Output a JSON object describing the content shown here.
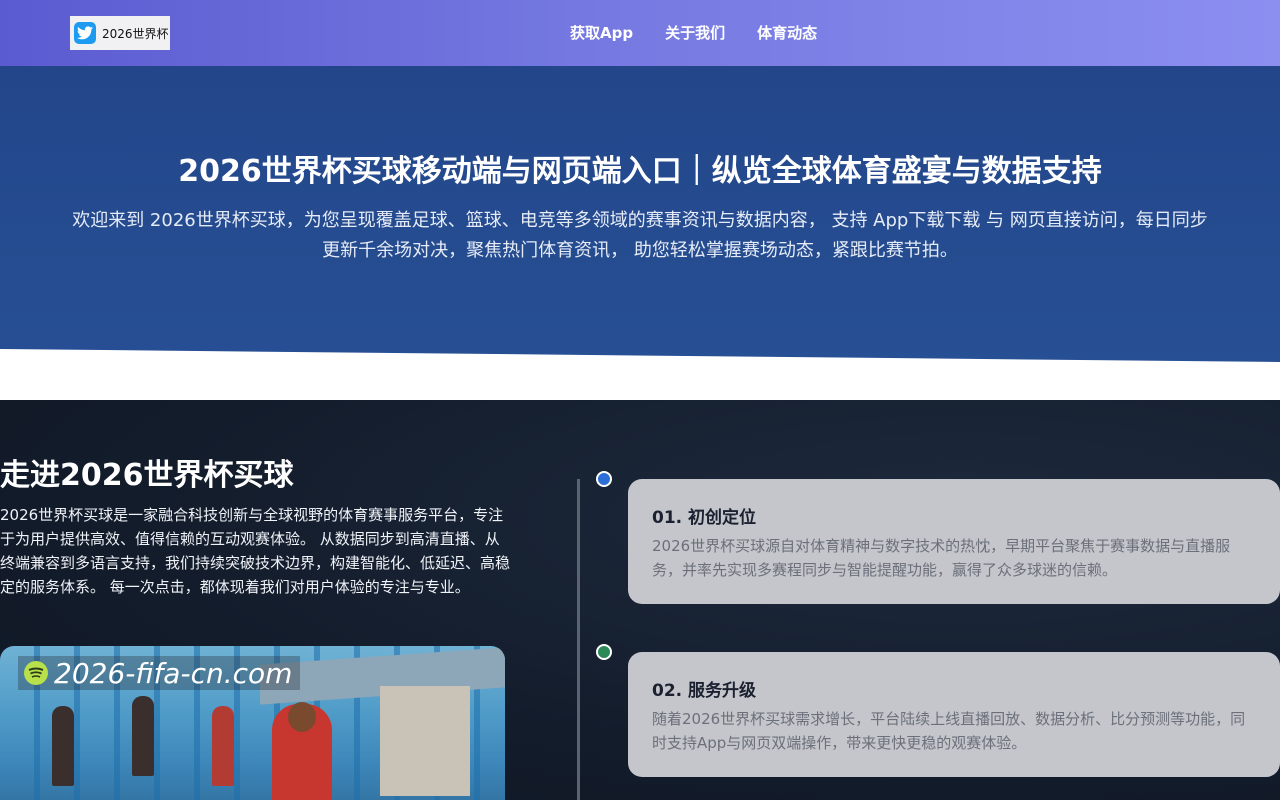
{
  "header": {
    "logo_text": "2026世界杯",
    "nav": [
      "获取App",
      "关于我们",
      "体育动态"
    ]
  },
  "hero": {
    "title": "2026世界杯买球移动端与网页端入口｜纵览全球体育盛宴与数据支持",
    "description": "欢迎来到 2026世界杯买球，为您呈现覆盖足球、篮球、电竞等多领域的赛事资讯与数据内容， 支持 App下载下载 与 网页直接访问，每日同步更新千余场对决，聚焦热门体育资讯， 助您轻松掌握赛场动态，紧跟比赛节拍。"
  },
  "about": {
    "title": "走进2026世界杯买球",
    "text": "2026世界杯买球是一家融合科技创新与全球视野的体育赛事服务平台，专注于为用户提供高效、值得信赖的互动观赛体验。 从数据同步到高清直播、从终端兼容到多语言支持，我们持续突破技术边界，构建智能化、低延迟、高稳定的服务体系。 每一次点击，都体现着我们对用户体验的专注与专业。",
    "image_watermark": "2026-fifa-cn.com"
  },
  "timeline": [
    {
      "title": "01. 初创定位",
      "text": "2026世界杯买球源自对体育精神与数字技术的热忱，早期平台聚焦于赛事数据与直播服务，并率先实现多赛程同步与智能提醒功能，赢得了众多球迷的信赖。"
    },
    {
      "title": "02. 服务升级",
      "text": "随着2026世界杯买球需求增长，平台陆续上线直播回放、数据分析、比分预测等功能，同时支持App与网页双端操作，带来更快更稳的观赛体验。"
    }
  ],
  "colors": {
    "nav_gradient_start": "#5b5bd1",
    "nav_gradient_end": "#8c8ff0",
    "hero_bg": "#23468a",
    "about_bg": "#131c2b",
    "card_bg": "#c4c6cb",
    "dot_1": "#2d6fd8",
    "dot_2": "#2b8a57"
  },
  "icons": {
    "logo": "twitter-bird-icon",
    "watermark": "spotify-icon"
  }
}
